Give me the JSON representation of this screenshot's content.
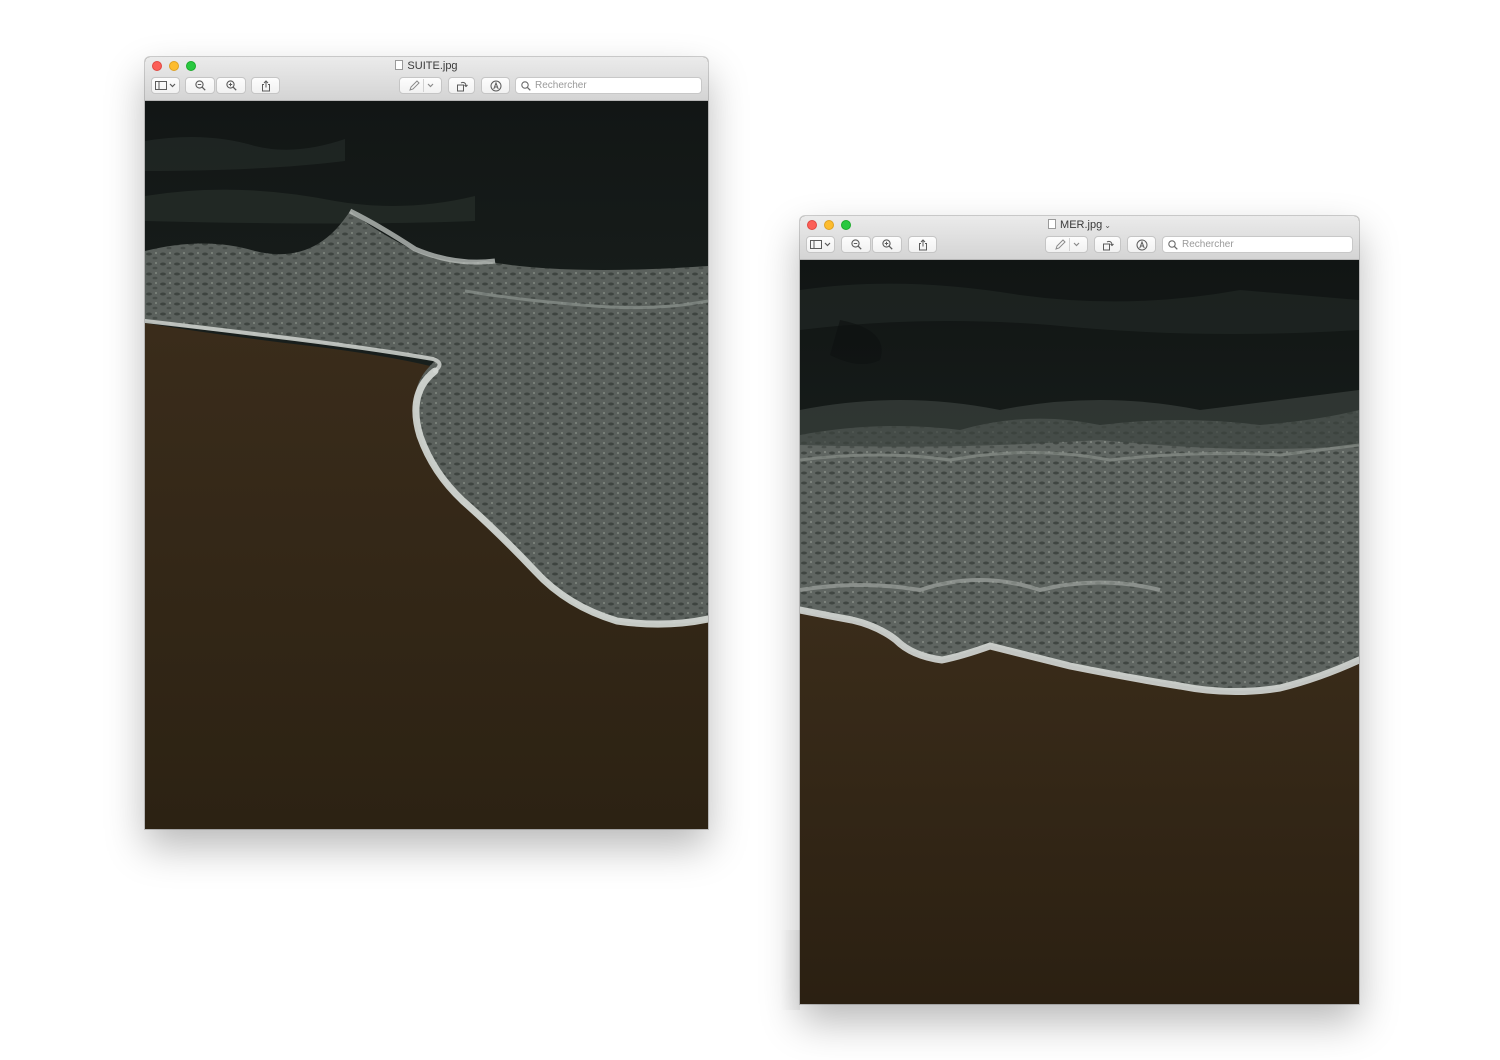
{
  "windows": [
    {
      "filename": "SUITE.jpg",
      "search_placeholder": "Rechercher",
      "image_description_icon": "photo"
    },
    {
      "filename": "MER.jpg",
      "search_placeholder": "Rechercher",
      "title_menu_icon": "chevron-down-icon"
    }
  ],
  "toolbar_icons": [
    "sidebar-icon",
    "zoom-out-icon",
    "zoom-in-icon",
    "share-icon",
    "markup-pen-icon",
    "chevron-down-icon",
    "rotate-icon",
    "annotate-icon",
    "search-icon"
  ],
  "colors": {
    "close": "#fc5f57",
    "minimize": "#fdbc2e",
    "maximize": "#29c840",
    "sand": "#2f2517",
    "sea": "#141b18",
    "foam": "#9aa19d"
  }
}
